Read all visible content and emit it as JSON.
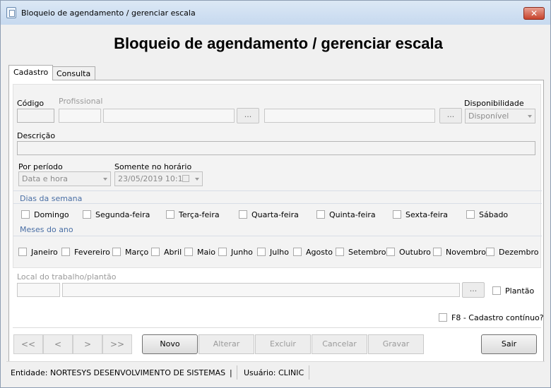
{
  "window": {
    "title": "Bloqueio de agendamento / gerenciar escala",
    "close_label": "✕"
  },
  "heading": "Bloqueio de agendamento / gerenciar escala",
  "tabs": [
    "Cadastro",
    "Consulta"
  ],
  "form": {
    "codigo_label": "Código",
    "profissional_label": "Profissional",
    "disponibilidade_label": "Disponibilidade",
    "disponibilidade_value": "Disponível",
    "descricao_label": "Descrição",
    "por_periodo_label": "Por período",
    "por_periodo_value": "Data e hora",
    "somente_label": "Somente no horário",
    "somente_value": "23/05/2019 10:19",
    "dots_label": "...",
    "dias_label": "Dias da semana",
    "dias": [
      "Domingo",
      "Segunda-feira",
      "Terça-feira",
      "Quarta-feira",
      "Quinta-feira",
      "Sexta-feira",
      "Sábado"
    ],
    "meses_label": "Meses do ano",
    "meses": [
      "Janeiro",
      "Fevereiro",
      "Março",
      "Abril",
      "Maio",
      "Junho",
      "Julho",
      "Agosto",
      "Setembro",
      "Outubro",
      "Novembro",
      "Dezembro"
    ],
    "local_label": "Local do trabalho/plantão",
    "plantao_label": "Plantão",
    "f8_label": "F8 - Cadastro contínuo?"
  },
  "nav": [
    "<<",
    "<",
    ">",
    ">>"
  ],
  "actions": {
    "novo": "Novo",
    "alterar": "Alterar",
    "excluir": "Excluir",
    "cancelar": "Cancelar",
    "gravar": "Gravar",
    "sair": "Sair"
  },
  "status": {
    "entidade": "Entidade: NORTESYS DESENVOLVIMENTO DE SISTEMAS",
    "divider": "|",
    "usuario": "Usuário: CLINIC"
  }
}
